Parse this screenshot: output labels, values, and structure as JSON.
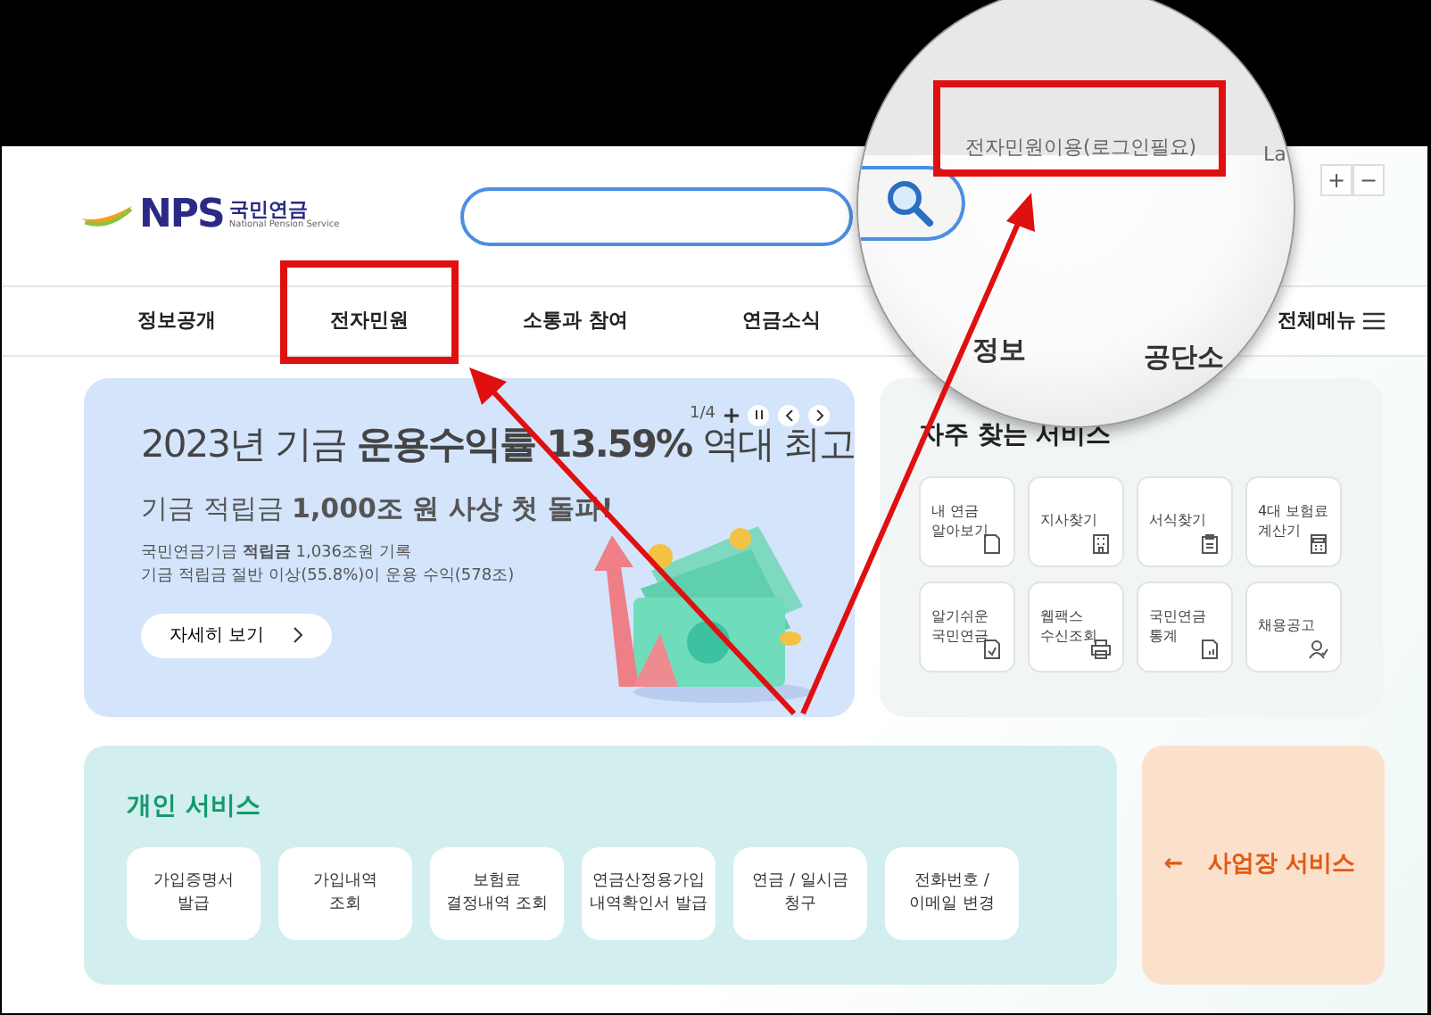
{
  "logo": {
    "mark": "NPS",
    "name": "국민연금",
    "tagline": "National Pension Service"
  },
  "zoom_buttons": [
    "+",
    "−"
  ],
  "nav": [
    {
      "label": "정보공개",
      "highlighted": false
    },
    {
      "label": "전자민원",
      "highlighted": true
    },
    {
      "label": "소통과 참여",
      "highlighted": false
    },
    {
      "label": "연금소식",
      "highlighted": false
    }
  ],
  "all_menu": "전체메뉴",
  "banner": {
    "counter": "1/4",
    "title": "2023년 기금 **운용수익률 13.59%** 역대 최고",
    "subtitle": "기금 적립금 **1,000조 원 사상 첫 돌파!**",
    "lines": [
      "국민연금기금 **적립금** 1,036조원 기록",
      "기금 적립금 절반 이상(55.8%)이 운용 수익(578조)"
    ],
    "button": "자세히 보기"
  },
  "quick_services": {
    "title": "자주 찾는 서비스",
    "items": [
      {
        "label": "내 연금\n알아보기"
      },
      {
        "label": "지사찾기"
      },
      {
        "label": "서식찾기"
      },
      {
        "label": "4대 보험료\n계산기"
      },
      {
        "label": "알기쉬운\n국민연금"
      },
      {
        "label": "웹팩스\n수신조회"
      },
      {
        "label": "국민연금\n통계"
      },
      {
        "label": "채용공고"
      }
    ]
  },
  "personal_services": {
    "title": "개인 서비스",
    "items": [
      "가입증명서\n발급",
      "가입내역\n조회",
      "보험료\n결정내역 조회",
      "연금산정용가입\n내역확인서 발급",
      "연금 / 일시금\n청구",
      "전화번호 /\n이메일 변경"
    ]
  },
  "business_services": {
    "arrow": "←",
    "title": "사업장 서비스"
  },
  "magnifier": {
    "link": "전자민원이용(로그인필요)",
    "link_highlighted": true,
    "language": "La",
    "nav": [
      "정보",
      "공단소"
    ]
  }
}
